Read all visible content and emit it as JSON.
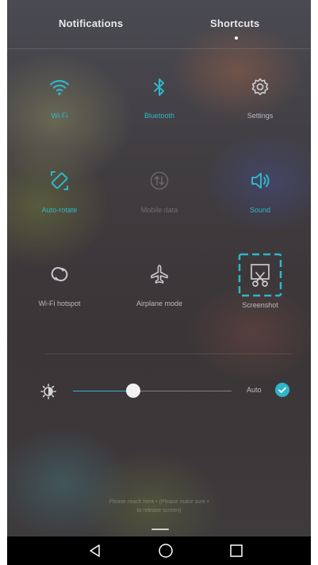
{
  "tabs": {
    "notifications": "Notifications",
    "shortcuts": "Shortcuts",
    "active": "shortcuts"
  },
  "shortcuts": [
    {
      "label": "Wi-Fi",
      "icon": "wifi-icon",
      "state": "on"
    },
    {
      "label": "Bluetooth",
      "icon": "bluetooth-icon",
      "state": "on"
    },
    {
      "label": "Settings",
      "icon": "gear-icon",
      "state": "off"
    },
    {
      "label": "Auto-rotate",
      "icon": "auto-rotate-icon",
      "state": "on"
    },
    {
      "label": "Mobile data",
      "icon": "mobile-data-icon",
      "state": "disabled"
    },
    {
      "label": "Sound",
      "icon": "speaker-icon",
      "state": "on"
    },
    {
      "label": "Wi-Fi hotspot",
      "icon": "hotspot-icon",
      "state": "off"
    },
    {
      "label": "Airplane mode",
      "icon": "airplane-icon",
      "state": "off"
    },
    {
      "label": "Screenshot",
      "icon": "screenshot-icon",
      "state": "off",
      "highlighted": true
    }
  ],
  "brightness": {
    "level": 0.38,
    "auto_label": "Auto",
    "auto_enabled": true
  },
  "footer": {
    "line1": "Please reach here • (Please make sure •",
    "line2": "to release screen)"
  },
  "navbar": {
    "back": "back-icon",
    "home": "home-icon",
    "recent": "recent-apps-icon"
  },
  "colors": {
    "accent": "#2fb6c8",
    "inactive": "#b9b9bb",
    "disabled": "#6f6f73"
  }
}
